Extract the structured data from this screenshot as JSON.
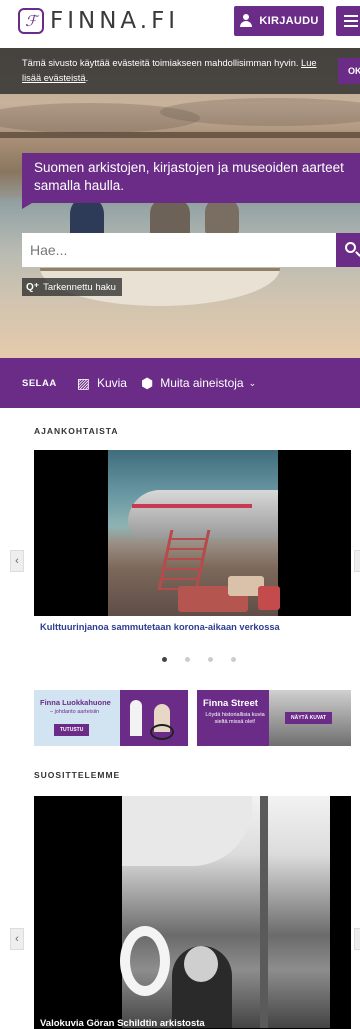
{
  "header": {
    "logo_text": "FINNA.FI",
    "logo_mark": "ℱ",
    "login_label": "KIRJAUDU"
  },
  "cookie": {
    "text": "Tämä sivusto käyttää evästeitä toimiakseen mahdollisimman hyvin.",
    "link": "Lue lisää evästeistä",
    "ok": "OK"
  },
  "hero": {
    "tagline": "Suomen arkistojen, kirjastojen ja museoiden aarteet samalla haulla.",
    "search_placeholder": "Hae...",
    "advanced_label": "Tarkennettu haku"
  },
  "browse": {
    "label": "SELAA",
    "items": [
      {
        "label": "Kuvia",
        "icon": "image-icon"
      },
      {
        "label": "Muita aineistoja",
        "icon": "box-icon"
      }
    ]
  },
  "news": {
    "title": "AJANKOHTAISTA",
    "caption": "Kulttuurinjanoa sammutetaan korona-aikaan verkossa",
    "dots": 4,
    "active_dot": 1
  },
  "banners": {
    "luokka": {
      "title": "Finna Luokkahuone",
      "subtitle": "– johdanto aarteisiin",
      "button": "TUTUSTU"
    },
    "street": {
      "title": "Finna Street",
      "subtitle": "Löydä historiallisia kuvia sieltä missä olet!",
      "button": "NÄYTÄ KUVAT"
    }
  },
  "recommend": {
    "title": "SUOSITTELEMME",
    "caption": "Valokuvia Göran Schildtin arkistosta"
  },
  "colors": {
    "brand": "#6a2c86",
    "link": "#2d3e8f"
  }
}
